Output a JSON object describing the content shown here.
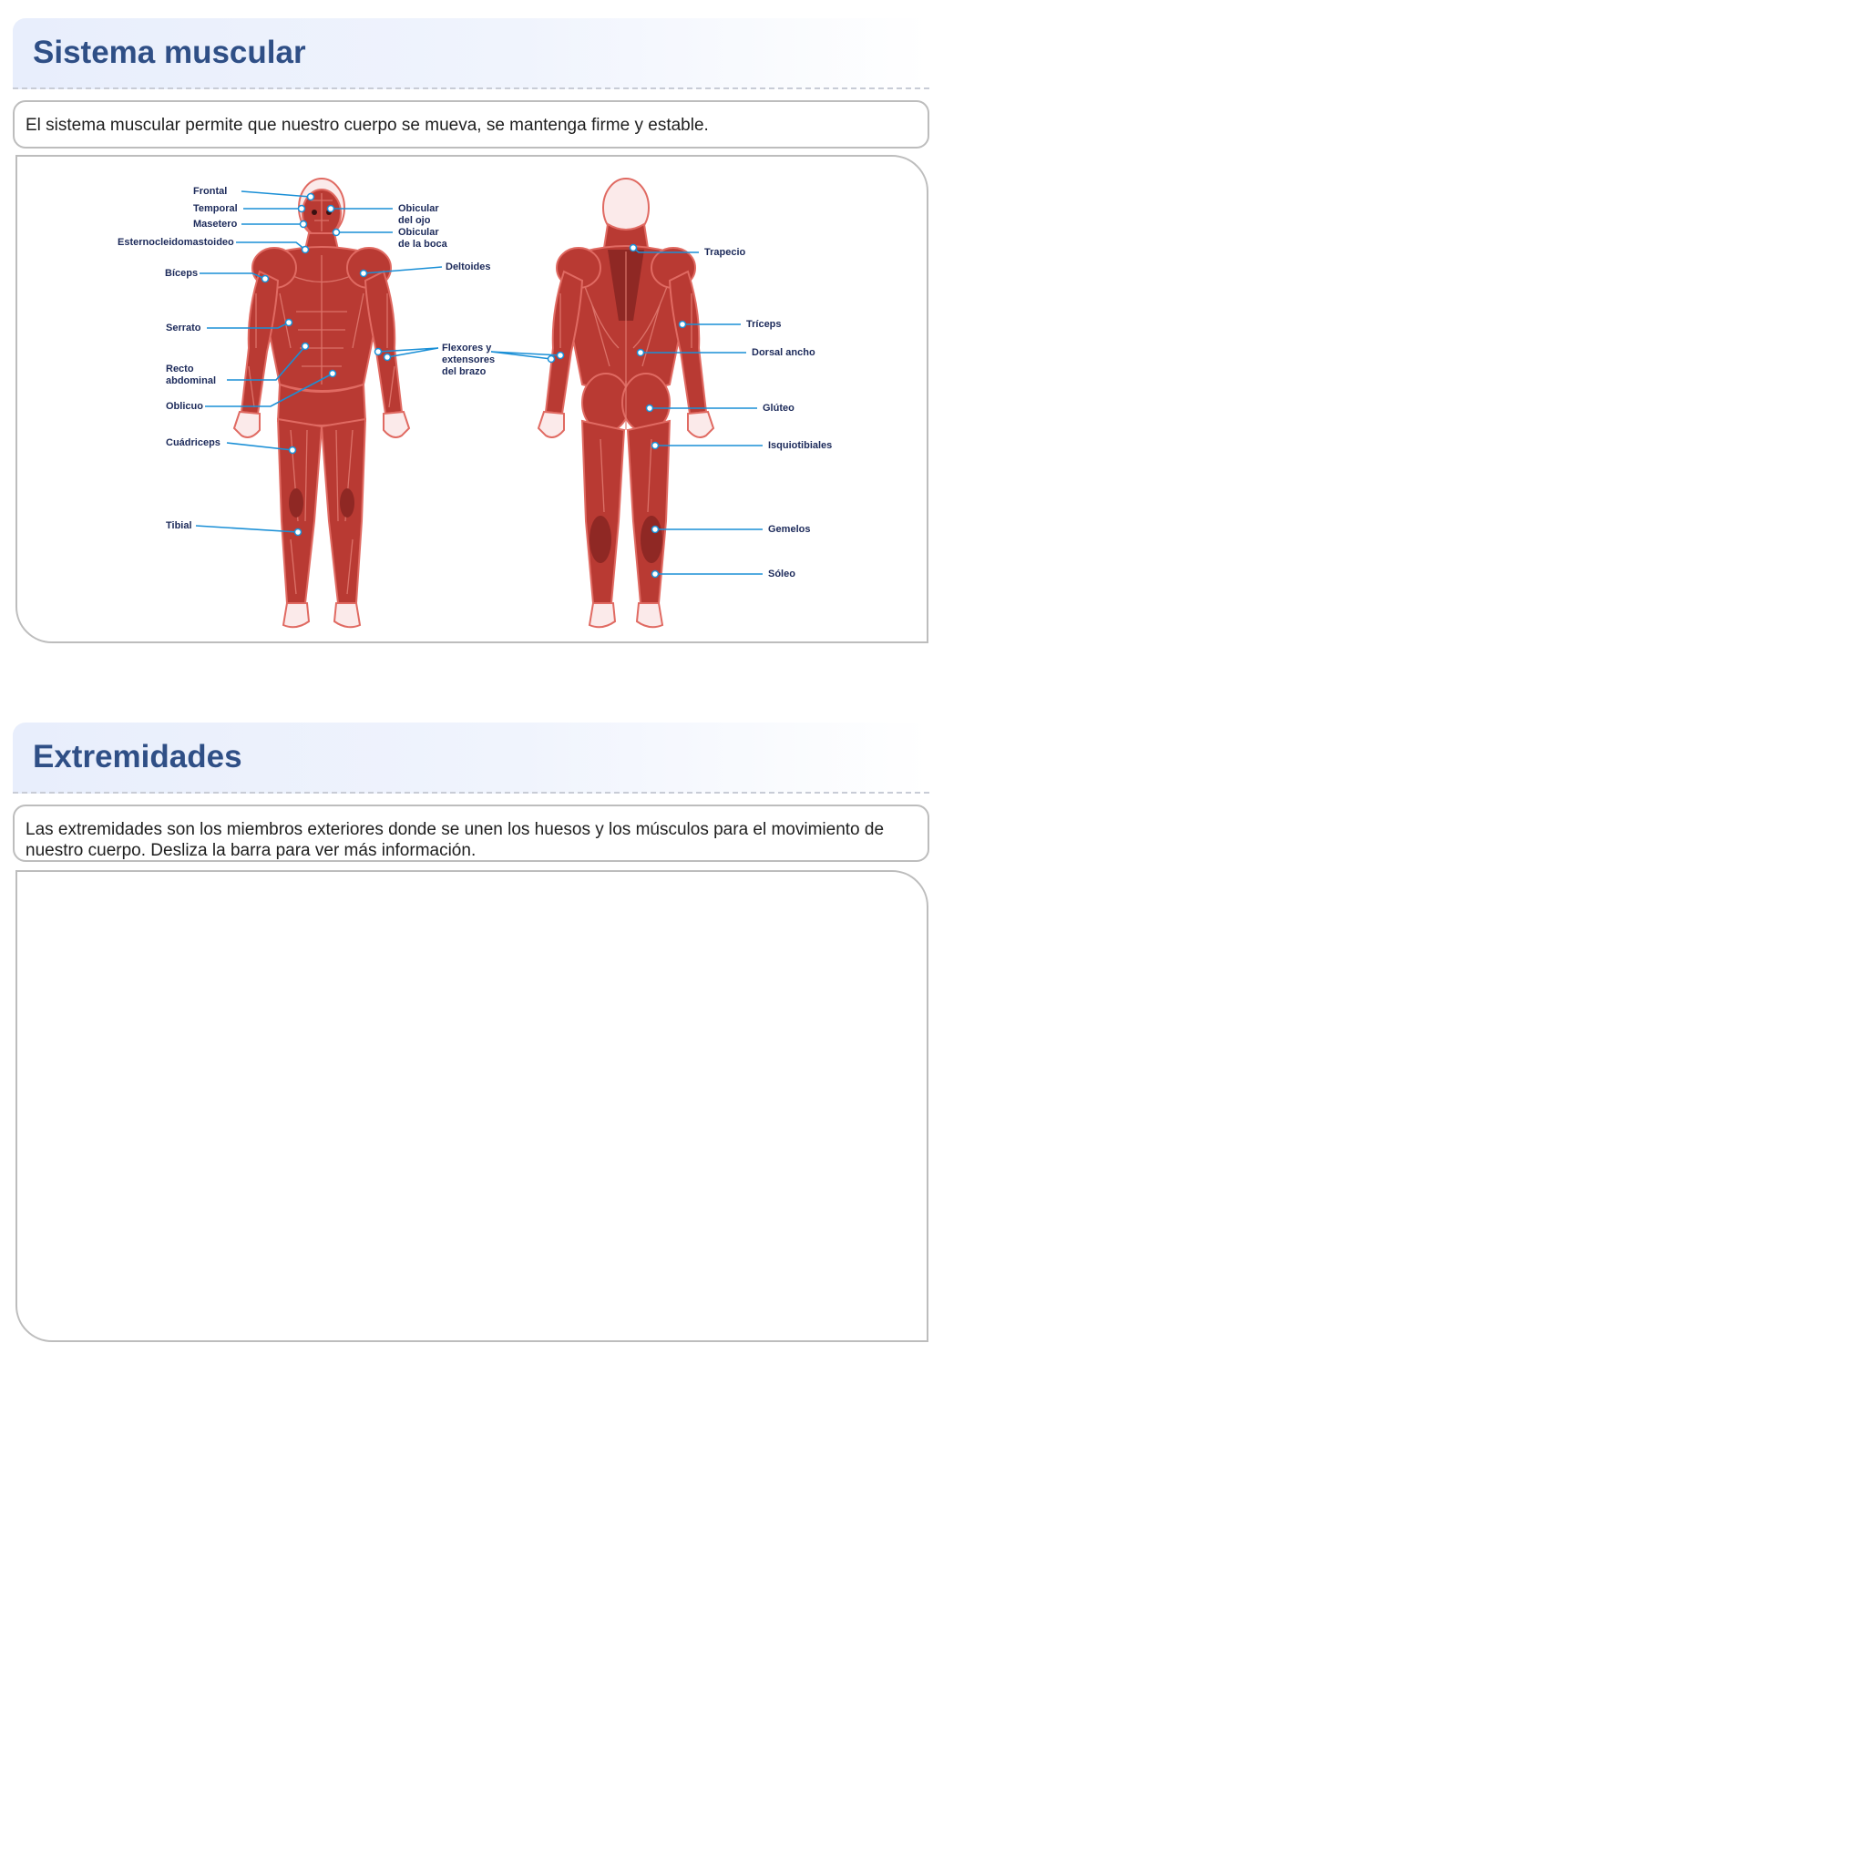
{
  "section1": {
    "title": "Sistema muscular",
    "description": "El sistema muscular permite que nuestro cuerpo se mueva, se mantenga firme y estable.",
    "diagram": {
      "labels_front_left": [
        "Frontal",
        "Temporal",
        "Masetero",
        "Esternocleidomastoideo",
        "Bíceps",
        "Serrato",
        "Recto",
        "abdominal",
        "Oblicuo",
        "Cuádriceps",
        "Tibial"
      ],
      "labels_front_right": [
        "Obicular",
        "del ojo",
        "Obicular",
        "de la boca",
        "Deltoides",
        "Flexores y",
        "extensores",
        "del brazo"
      ],
      "labels_back_right": [
        "Trapecio",
        "Tríceps",
        "Dorsal ancho",
        "Glúteo",
        "Isquiotibiales",
        "Gemelos",
        "Sóleo"
      ]
    }
  },
  "section2": {
    "title": "Extremidades",
    "description": "Las extremidades son los miembros exteriores donde se unen los huesos y los músculos para el movimiento de nuestro cuerpo. Desliza la barra para ver más información."
  },
  "colors": {
    "title": "#2f4f86",
    "muscle": "#b93a33",
    "label_line": "#1a8fd6",
    "label_text": "#1c2a5a"
  }
}
